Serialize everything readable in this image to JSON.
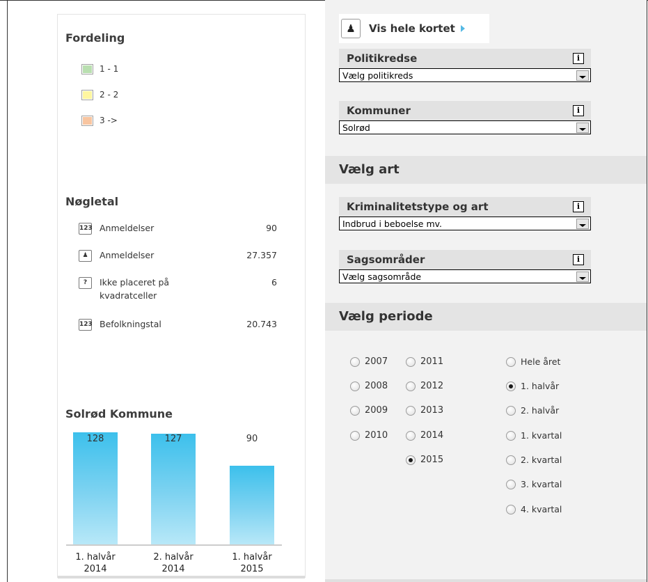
{
  "distribution": {
    "title": "Fordeling",
    "items": [
      {
        "label": "1 - 1",
        "color": "#b9dfb0"
      },
      {
        "label": "2 - 2",
        "color": "#fff6a0"
      },
      {
        "label": "3 ->",
        "color": "#f8c5a0"
      }
    ]
  },
  "key_figures": {
    "title": "Nøgletal",
    "rows": [
      {
        "icon": "123-icon",
        "icon_text": "123",
        "label": "Anmeldelser",
        "value": "90"
      },
      {
        "icon": "map-icon",
        "icon_text": "",
        "label": "Anmeldelser",
        "value": "27.357"
      },
      {
        "icon": "question-icon",
        "icon_text": "?",
        "label": "Ikke placeret på kvadratceller",
        "value": "6"
      },
      {
        "icon": "123-icon",
        "icon_text": "123",
        "label": "Befolkningstal",
        "value": "20.743"
      }
    ]
  },
  "chart_data": {
    "type": "bar",
    "title": "Solrød Kommune",
    "categories": [
      "1. halvår\n2014",
      "2. halvår\n2014",
      "1. halvår\n2015"
    ],
    "values": [
      128,
      127,
      90
    ],
    "value_labels": [
      "128",
      "127",
      "90"
    ],
    "category_line1": [
      "1. halvår",
      "2. halvår",
      "1. halvår"
    ],
    "category_line2": [
      "2014",
      "2014",
      "2015"
    ],
    "ylim": [
      0,
      180
    ],
    "grid": false,
    "bar_color": "#3cc0ec"
  },
  "map_link": {
    "label": "Vis hele kortet"
  },
  "filters": {
    "constituencies": {
      "title": "Politikredse",
      "info": "i",
      "value": "Vælg politikreds"
    },
    "municipalities": {
      "title": "Kommuner",
      "info": "i",
      "value": "Solrød"
    },
    "crime_type": {
      "title": "Kriminalitetstype og art",
      "info": "i",
      "value": "Indbrud i beboelse mv."
    },
    "case_areas": {
      "title": "Sagsområder",
      "info": "i",
      "value": "Vælg sagsområde"
    }
  },
  "sections": {
    "choose_type": "Vælg art",
    "choose_period": "Vælg periode"
  },
  "years": [
    {
      "label": "2007",
      "checked": false
    },
    {
      "label": "2008",
      "checked": false
    },
    {
      "label": "2009",
      "checked": false
    },
    {
      "label": "2010",
      "checked": false
    },
    {
      "label": "2011",
      "checked": false
    },
    {
      "label": "2012",
      "checked": false
    },
    {
      "label": "2013",
      "checked": false
    },
    {
      "label": "2014",
      "checked": false
    },
    {
      "label": "2015",
      "checked": true
    }
  ],
  "periods": [
    {
      "label": "Hele året",
      "checked": false
    },
    {
      "label": "1. halvår",
      "checked": true
    },
    {
      "label": "2. halvår",
      "checked": false
    },
    {
      "label": "1. kvartal",
      "checked": false
    },
    {
      "label": "2. kvartal",
      "checked": false
    },
    {
      "label": "3. kvartal",
      "checked": false
    },
    {
      "label": "4. kvartal",
      "checked": false
    }
  ]
}
